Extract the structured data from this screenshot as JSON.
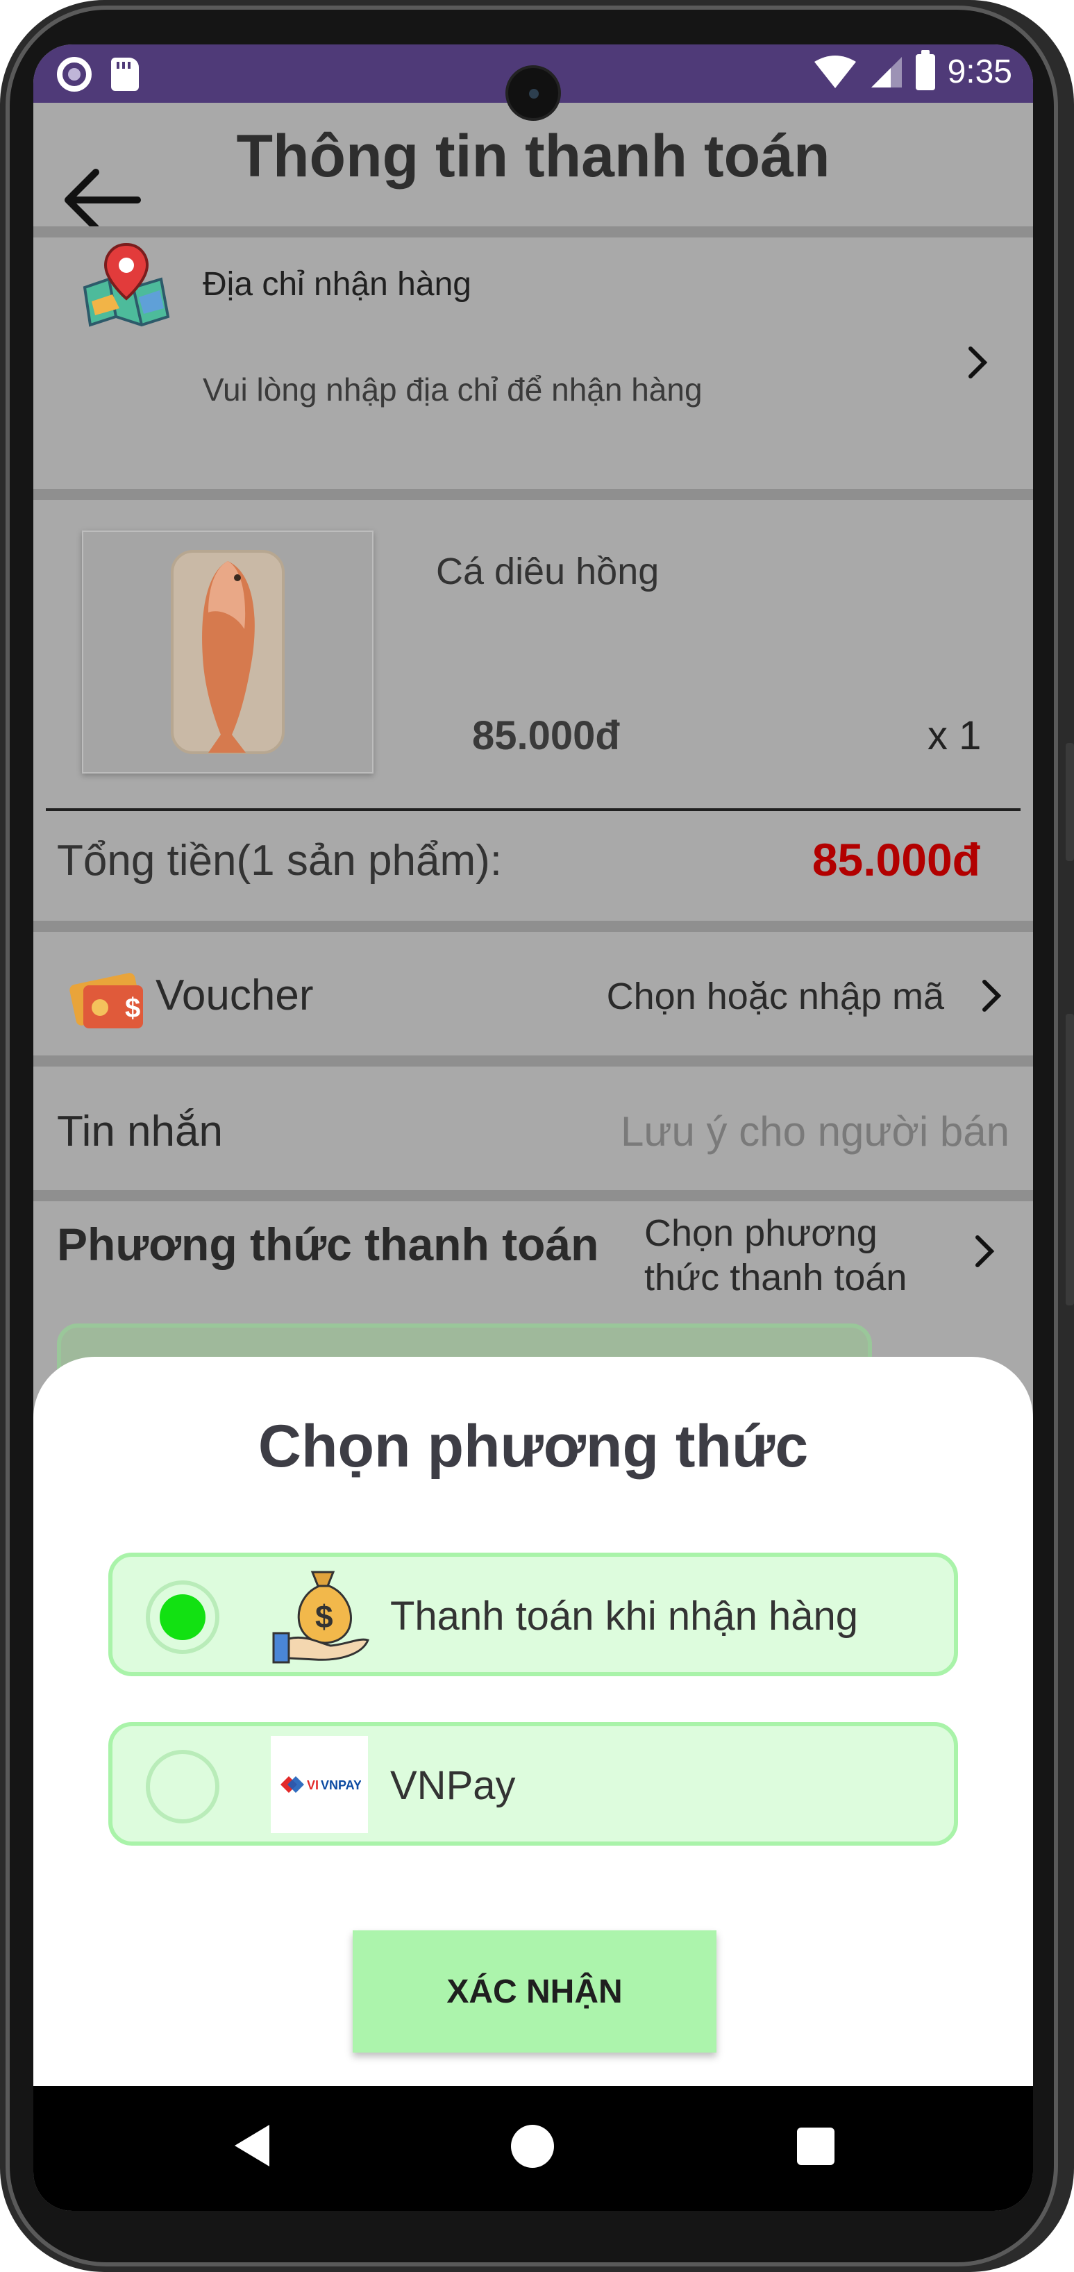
{
  "status_bar": {
    "time": "9:35"
  },
  "appbar": {
    "title": "Thông tin thanh toán"
  },
  "address": {
    "title": "Địa chỉ nhận hàng",
    "hint": "Vui lòng nhập địa chỉ để nhận hàng"
  },
  "product": {
    "name": "Cá diêu hồng",
    "price": "85.000đ",
    "quantity": "x 1"
  },
  "total": {
    "label": "Tổng tiền(1 sản phẩm):",
    "value": "85.000đ"
  },
  "voucher": {
    "label": "Voucher",
    "action": "Chọn hoặc nhập mã"
  },
  "message": {
    "label": "Tin nhắn",
    "placeholder": "Lưu ý cho người bán"
  },
  "payment": {
    "label": "Phương thức thanh toán",
    "action": "Chọn phương thức thanh toán"
  },
  "sheet": {
    "title": "Chọn phương thức",
    "options": [
      {
        "label": "Thanh toán khi nhận hàng",
        "icon": "money-bag-hand-icon",
        "selected": true
      },
      {
        "label": "VNPay",
        "icon": "vnpay-logo",
        "selected": false
      }
    ],
    "confirm_label": "XÁC NHẬN"
  },
  "colors": {
    "status_bar": "#4f3a78",
    "total_value": "#b20000",
    "option_bg": "#ddfcdd",
    "option_border": "#a9f3a9",
    "radio_selected": "#12e112",
    "confirm_bg": "#acf4ac"
  }
}
